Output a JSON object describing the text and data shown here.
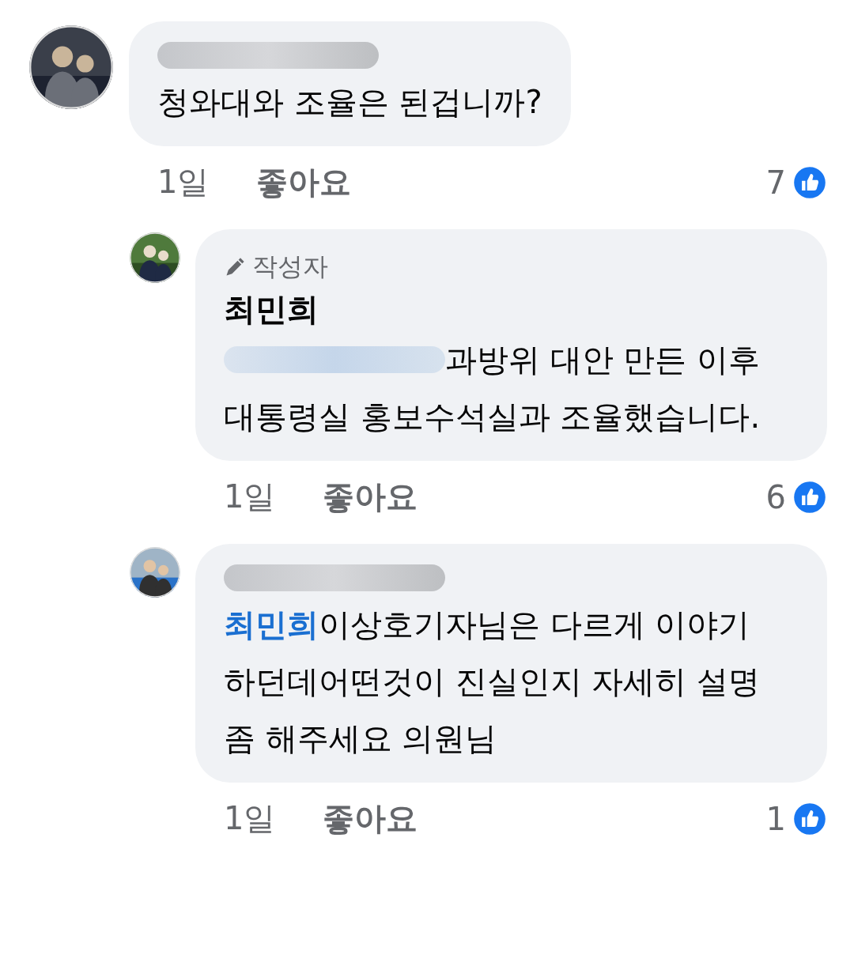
{
  "comments": [
    {
      "reply": false,
      "name_blurred": true,
      "mention_blurred": false,
      "text": "청와대와 조율은 된겁니까?",
      "time": "1일",
      "like_label": "좋아요",
      "like_count": "7"
    },
    {
      "reply": true,
      "name_blurred": false,
      "author_badge": "작성자",
      "author": "최민희",
      "mention_blurred": true,
      "text": "과방위 대안 만든 이후 대통령실 홍보수석실과 조율했습니다.",
      "time": "1일",
      "like_label": "좋아요",
      "like_count": "6"
    },
    {
      "reply": true,
      "name_blurred": true,
      "mention": "최민희",
      "mention_blurred": false,
      "text": "이상호기자님은 다르게 이야기 하던데어떤것이 진실인지 자세히 설명 좀 해주세요 의원님",
      "time": "1일",
      "like_label": "좋아요",
      "like_count": "1"
    }
  ]
}
